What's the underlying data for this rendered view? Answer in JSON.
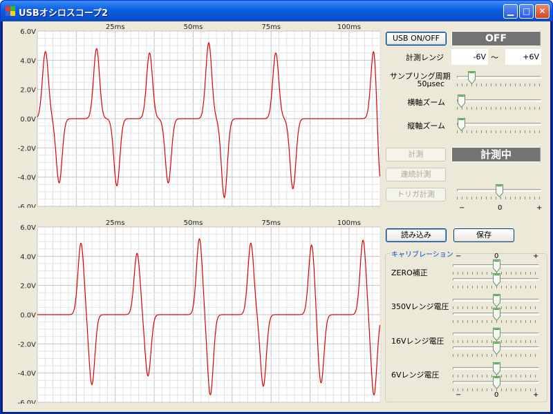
{
  "window": {
    "title": "USBオシロスコープ2"
  },
  "plots": [
    {
      "xticks": [
        "25ms",
        "50ms",
        "75ms",
        "100ms"
      ],
      "yticks": [
        "6.0V",
        "4.0V",
        "2.0V",
        "0.0V",
        "-2.0V",
        "-4.0V",
        "-6.0V"
      ]
    },
    {
      "xticks": [
        "25ms",
        "50ms",
        "75ms",
        "100ms"
      ],
      "yticks": [
        "6.0V",
        "4.0V",
        "2.0V",
        "0.0V",
        "-2.0V",
        "-4.0V",
        "-6.0V"
      ]
    }
  ],
  "chart_data": [
    {
      "type": "line",
      "xlim": [
        0,
        110
      ],
      "ylim": [
        -6,
        6
      ],
      "xunit": "ms",
      "yunit": "V",
      "grid": true,
      "series": [
        {
          "color": "#dd0000",
          "peaks": [
            {
              "x": 2.6,
              "y": 4.6
            },
            {
              "x": 19,
              "y": 4.8
            },
            {
              "x": 36,
              "y": 4.5
            },
            {
              "x": 55,
              "y": 5.2
            },
            {
              "x": 76.5,
              "y": 4.5
            },
            {
              "x": 108,
              "y": 5.0
            }
          ],
          "troughs": [
            {
              "x": 7,
              "y": -4.4
            },
            {
              "x": 25.5,
              "y": -4.6
            },
            {
              "x": 42,
              "y": -4.4
            },
            {
              "x": 60,
              "y": -5.4
            },
            {
              "x": 82,
              "y": -4.8
            },
            {
              "x": 110,
              "y": -4.6
            }
          ]
        }
      ]
    },
    {
      "type": "line",
      "xlim": [
        0,
        110
      ],
      "ylim": [
        -6,
        6
      ],
      "xunit": "ms",
      "yunit": "V",
      "grid": true,
      "series": [
        {
          "color": "#dd0000",
          "peaks": [
            {
              "x": 14,
              "y": 4.9
            },
            {
              "x": 32,
              "y": 4.2
            },
            {
              "x": 52,
              "y": 5.2
            },
            {
              "x": 68.5,
              "y": 4.9
            },
            {
              "x": 88,
              "y": 4.8
            },
            {
              "x": 104.5,
              "y": 5.1
            }
          ],
          "troughs": [
            {
              "x": 17.5,
              "y": -4.8
            },
            {
              "x": 35.5,
              "y": -4.2
            },
            {
              "x": 55.5,
              "y": -5.5
            },
            {
              "x": 72.5,
              "y": -4.9
            },
            {
              "x": 91,
              "y": -4.7
            },
            {
              "x": 108,
              "y": -5.5
            }
          ]
        }
      ]
    }
  ],
  "controls": {
    "usb_button": "USB ON/OFF",
    "status": "OFF",
    "range_label": "計測レンジ",
    "range_min": "-6V",
    "range_sep": "〜",
    "range_max": "+6V",
    "sampling_label": "サンプリング周期",
    "sampling_value": "50μsec",
    "hzoom_label": "横軸ズーム",
    "vzoom_label": "縦軸ズーム",
    "measure_button": "計測",
    "measuring_status": "計測中",
    "continuous_button": "連続計測",
    "trigger_button": "トリガ計測",
    "trigger_minus": "−",
    "trigger_zero": "0",
    "trigger_plus": "+",
    "load_button": "読み込み",
    "save_button": "保存"
  },
  "sliders": {
    "sampling": 0.14,
    "hzoom": 0.0,
    "vzoom": 0.0,
    "trigger": 0.5
  },
  "calibration": {
    "title": "キャリブレーション",
    "scale_minus": "−",
    "scale_zero": "0",
    "scale_plus": "+",
    "rows": [
      {
        "label": "ZERO補正",
        "v1": 0.5,
        "v2": 0.5
      },
      {
        "label": "350Vレンジ電圧",
        "v1": 0.5,
        "v2": 0.5
      },
      {
        "label": "16Vレンジ電圧",
        "v1": 0.5,
        "v2": 0.5
      },
      {
        "label": "6Vレンジ電圧",
        "v1": 0.5,
        "v2": 0.5
      }
    ]
  }
}
